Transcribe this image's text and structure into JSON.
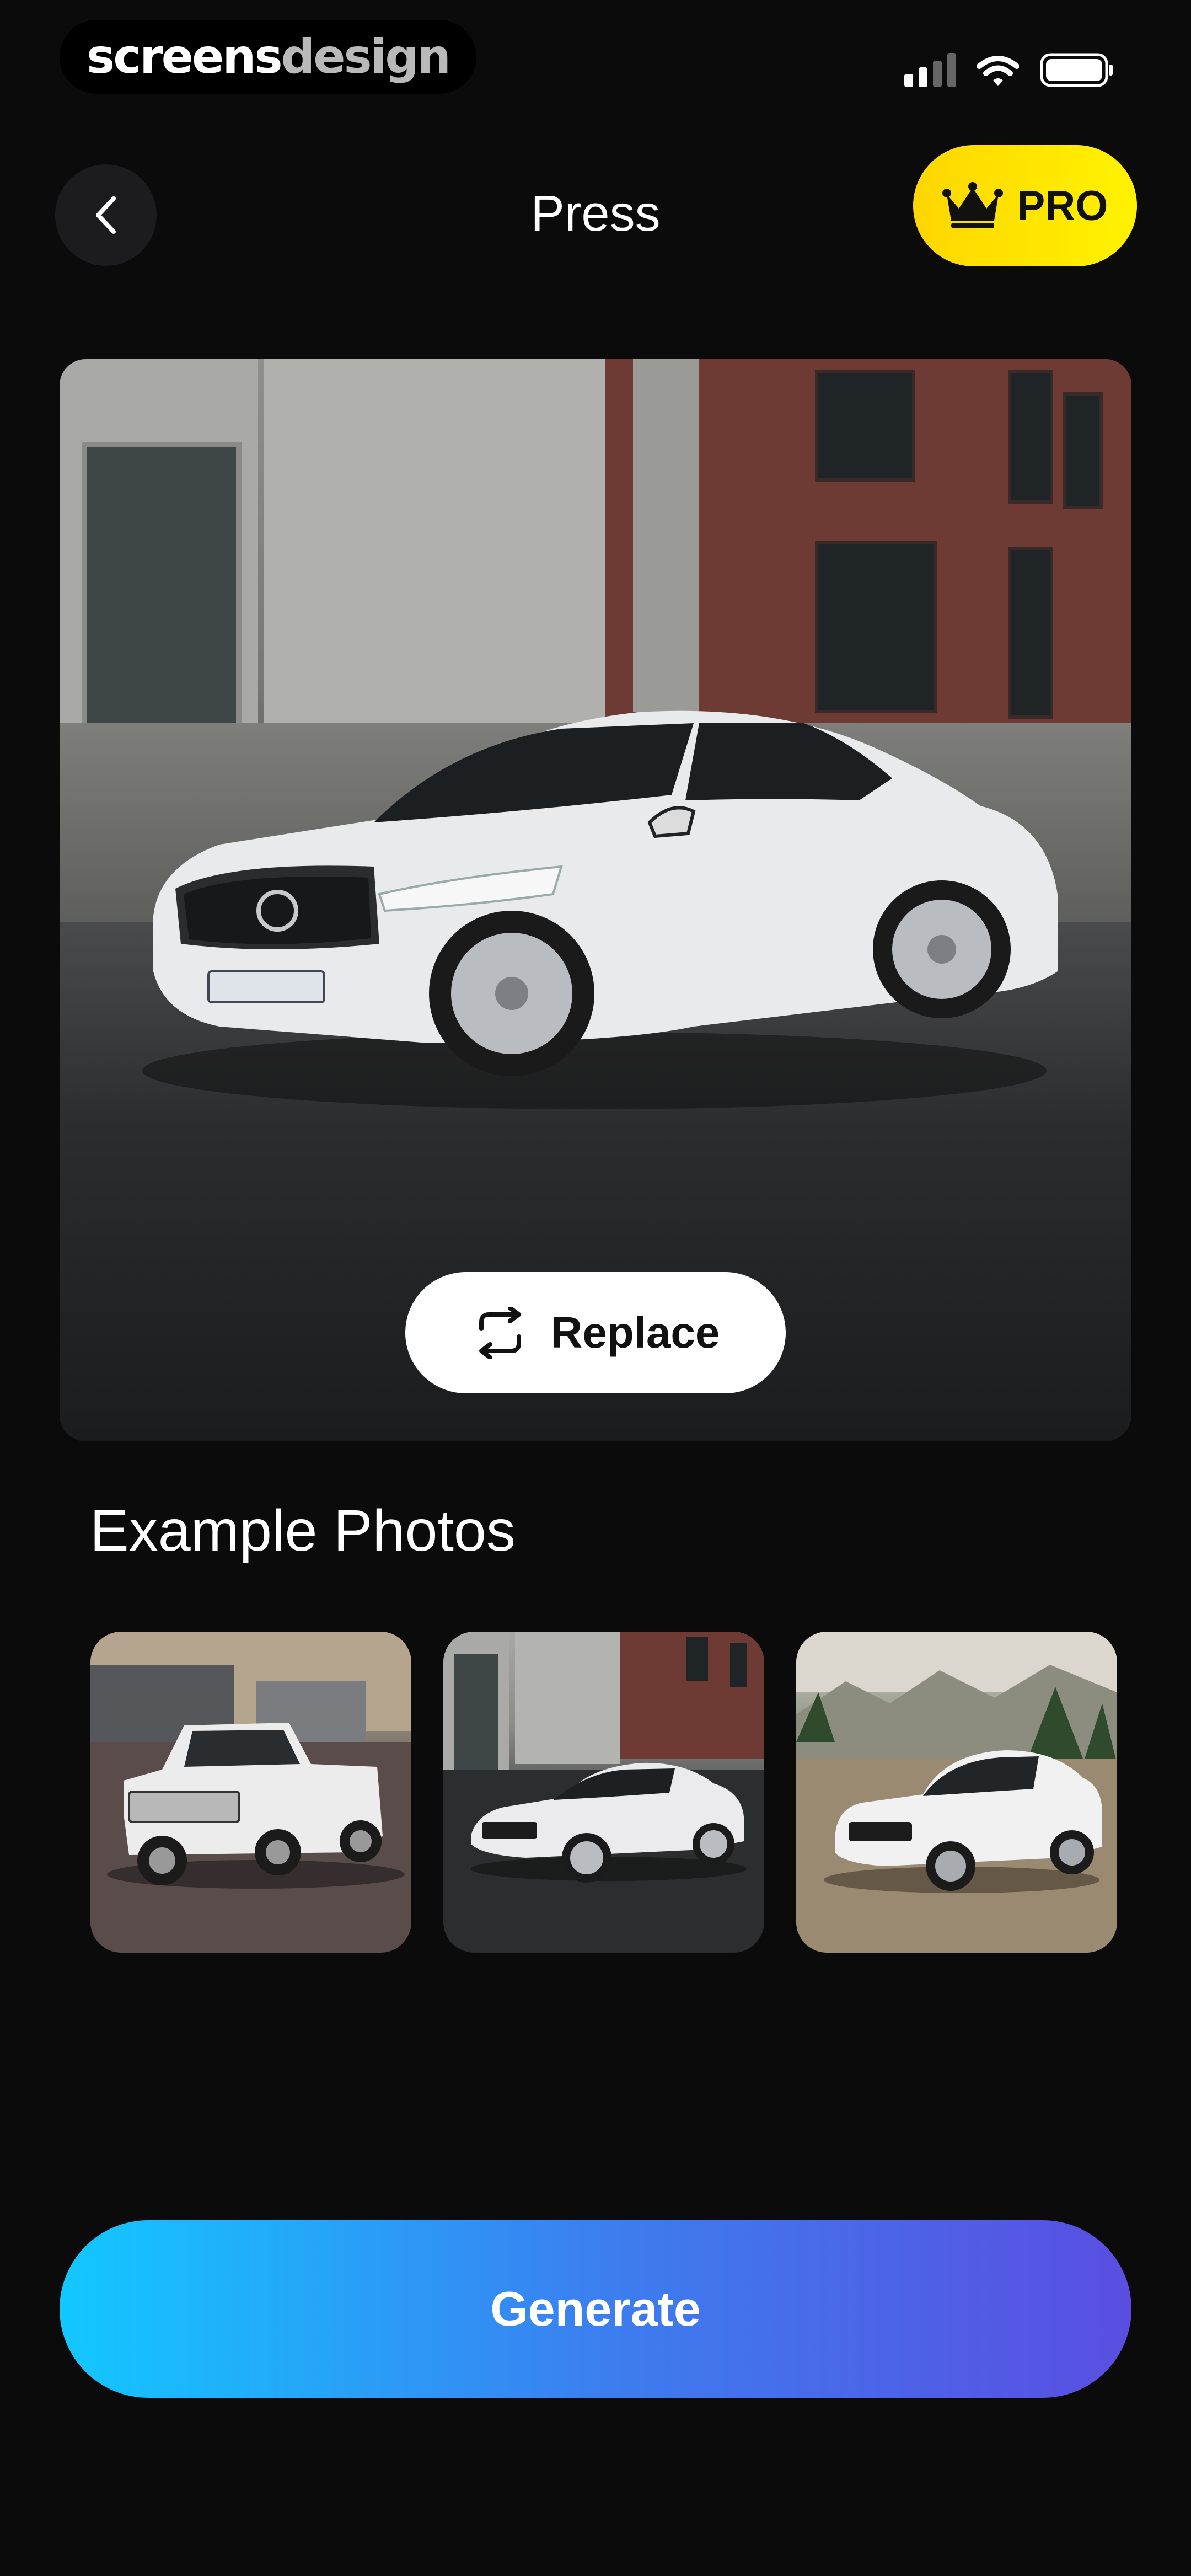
{
  "watermark": {
    "part1": "screens",
    "part2": "design"
  },
  "header": {
    "title": "Press",
    "pro_label": "PRO"
  },
  "main_photo": {
    "replace_label": "Replace"
  },
  "examples": {
    "title": "Example Photos",
    "items": [
      "pickup-truck-photo",
      "white-sedan-photo",
      "white-suv-photo"
    ]
  },
  "actions": {
    "generate_label": "Generate"
  },
  "colors": {
    "pro": "#FFE500",
    "gradient_start": "#12C8FF",
    "gradient_end": "#5A4EE0",
    "background": "#0B0B0C"
  }
}
